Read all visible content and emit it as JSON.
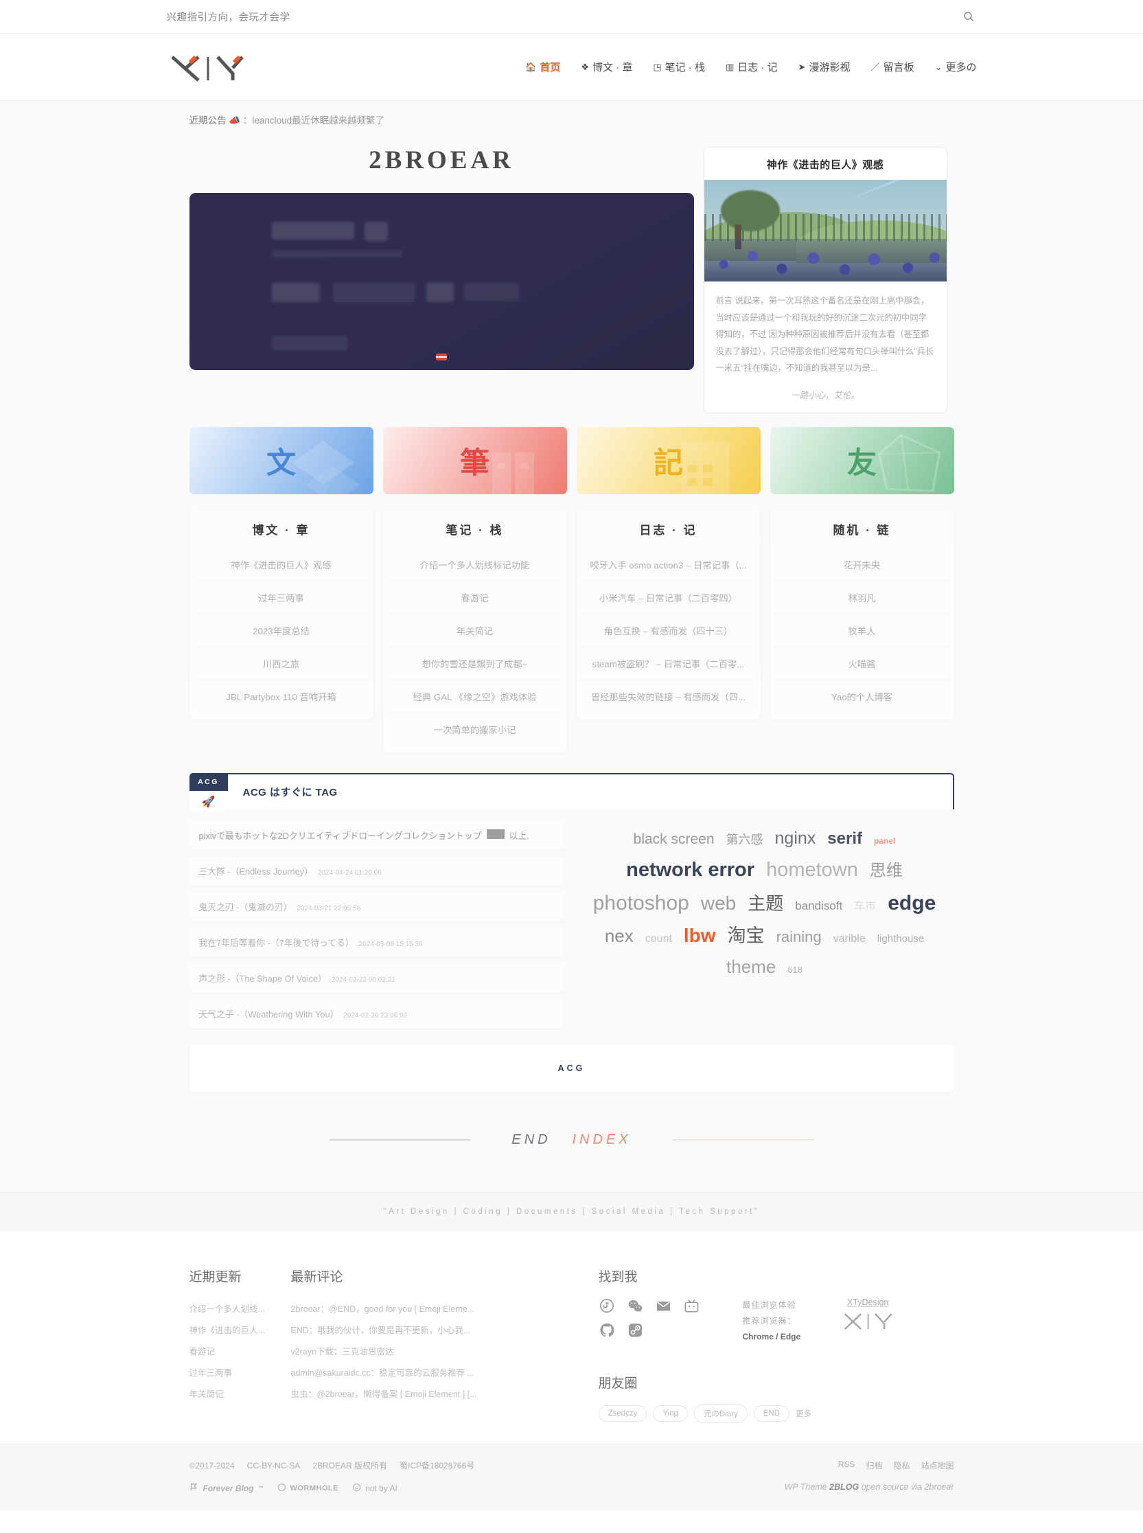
{
  "topbar": {
    "slogan": "兴趣指引方向，会玩才会学",
    "search_icon": "search-icon"
  },
  "header": {
    "logo_text": "XIY",
    "nav": [
      {
        "label": "首页",
        "icon": "home-icon",
        "active": true
      },
      {
        "label": "博文 · 章",
        "icon": "layers-icon",
        "active": false
      },
      {
        "label": "笔记 · 栈",
        "icon": "chart-icon",
        "active": false
      },
      {
        "label": "日志 · 记",
        "icon": "calendar-icon",
        "active": false
      },
      {
        "label": "漫游影视",
        "icon": "paper-plane-icon",
        "active": false
      },
      {
        "label": "留言板",
        "icon": "pen-icon",
        "active": false
      },
      {
        "label": "更多の",
        "icon": "chevron-down-icon",
        "active": false
      }
    ]
  },
  "notice": {
    "label": "近期公告",
    "icon": "megaphone-icon",
    "text": "：leancloud最近休眠越来越频繁了"
  },
  "hero": {
    "site_title": "2BROEAR"
  },
  "feature": {
    "title": "神作《进击的巨人》观感",
    "excerpt": "前言 说起来，第一次耳熟这个番名还是在刚上高中那会，当时应该是通过一个和我玩的好的沉迷二次元的初中同学得知的，不过 因为种种原因被推荐后并没有去看（甚至都没去了解过），只记得那会他们经常有句口头禅叫什么”兵长一米五“挂在嘴边，不知道的我甚至以为是...",
    "signature": "一路小心，艾伦。"
  },
  "categories": [
    {
      "glyph": "文",
      "color": "#4a86d8",
      "bg_from": "#eaf2fd",
      "bg_to": "#6ba3e6",
      "name": "category-card-wen"
    },
    {
      "glyph": "筆",
      "color": "#e04a44",
      "bg_from": "#fdecec",
      "bg_to": "#ef7b72",
      "name": "category-card-bi"
    },
    {
      "glyph": "記",
      "color": "#eab321",
      "bg_from": "#fdf7df",
      "bg_to": "#f6cf4e",
      "name": "category-card-ji"
    },
    {
      "glyph": "友",
      "color": "#4fa06b",
      "bg_from": "#eaf6ee",
      "bg_to": "#79c193",
      "name": "category-card-you"
    }
  ],
  "lists": [
    {
      "title": "博文 · 章",
      "items": [
        "神作《进击的巨人》观感",
        "过年三两事",
        "2023年度总结",
        "川西之旅",
        "JBL Partybox 110 音响开箱"
      ]
    },
    {
      "title": "笔记 · 栈",
      "items": [
        "介绍一个多人划线标记功能",
        "春游记",
        "年关简记",
        "想你的雪还是飘到了成都~",
        "经典 GAL 《缘之空》游戏体验",
        "一次简单的搬家小记"
      ]
    },
    {
      "title": "日志 · 记",
      "items": [
        "咬牙入手 osmo action3 – 日常记事（...",
        "小米汽车 – 日常记事（二百零四）",
        "角色互换 – 有感而发（四十三）",
        "steam被盗刷？ – 日常记事（二百零...",
        "曾经那些失效的链接 – 有感而发（四..."
      ]
    },
    {
      "title": "随机 · 链",
      "items": [
        "花开未央",
        "林羽凡",
        "牧羊人",
        "火喵酱",
        "Yao的个人博客"
      ]
    }
  ],
  "acg": {
    "tab_label": "ACG",
    "tab_icon": "rocket-icon",
    "bar_title": "ACG はすぐに TAG",
    "footer_label": "ACG",
    "anime": [
      {
        "title": "pixivで最もホットな2Dクリエイティブドローイングコレクショントップ",
        "redacted": true,
        "suffix": "以上.",
        "date": ""
      },
      {
        "title": "三大隊 -（Endless Journey）",
        "date": "2024-04-24 01:20:06"
      },
      {
        "title": "鬼灭之刃 -（鬼滅の刃）",
        "date": "2024-03-21 22:05:58"
      },
      {
        "title": "我在7年后等着你 -（7年後で待ってる）",
        "date": "2024-03-08 15:15:36"
      },
      {
        "title": "声之形 -（The Shape Of Voice）",
        "date": "2024-02-22 00:02:21"
      },
      {
        "title": "天气之子 -（Weathering With You）",
        "date": "2024-02-20 23:06:00"
      }
    ],
    "tags": [
      {
        "label": "black screen",
        "size": 21,
        "color": "#9a9a9a",
        "weight": 400
      },
      {
        "label": "第六感",
        "size": 18,
        "color": "#9f9f9f",
        "weight": 400
      },
      {
        "label": "nginx",
        "size": 25,
        "color": "#6d7480",
        "weight": 400
      },
      {
        "label": "serif",
        "size": 24,
        "color": "#4a5164",
        "weight": 700
      },
      {
        "label": "panel",
        "size": 12,
        "color": "#f19b8a",
        "weight": 700
      },
      {
        "label": "network error",
        "size": 29,
        "color": "#3c4558",
        "weight": 700
      },
      {
        "label": "hometown",
        "size": 29,
        "color": "#b3b3b3",
        "weight": 400
      },
      {
        "label": "思维",
        "size": 24,
        "color": "#9b9b9b",
        "weight": 400
      },
      {
        "label": "photoshop",
        "size": 30,
        "color": "#a0a0a0",
        "weight": 400
      },
      {
        "label": "web",
        "size": 28,
        "color": "#9d9d9d",
        "weight": 400
      },
      {
        "label": "主题",
        "size": 26,
        "color": "#5c5c5c",
        "weight": 400
      },
      {
        "label": "bandisoft",
        "size": 17,
        "color": "#909090",
        "weight": 400
      },
      {
        "label": "车市",
        "size": 16,
        "color": "#dcdcdc",
        "weight": 400
      },
      {
        "label": "edge",
        "size": 30,
        "color": "#3c4558",
        "weight": 700
      },
      {
        "label": "nex",
        "size": 26,
        "color": "#8d8d8d",
        "weight": 400
      },
      {
        "label": "count",
        "size": 16,
        "color": "#c2c2c2",
        "weight": 400
      },
      {
        "label": "lbw",
        "size": 28,
        "color": "#ef5b2b",
        "weight": 700
      },
      {
        "label": "淘宝",
        "size": 27,
        "color": "#606060",
        "weight": 400
      },
      {
        "label": "raining",
        "size": 22,
        "color": "#9e9e9e",
        "weight": 400
      },
      {
        "label": "varible",
        "size": 16,
        "color": "#b5b5b5",
        "weight": 400
      },
      {
        "label": "lighthouse",
        "size": 15,
        "color": "#b0b0b0",
        "weight": 400
      },
      {
        "label": "theme",
        "size": 26,
        "color": "#a5a5a5",
        "weight": 400
      },
      {
        "label": "618",
        "size": 13,
        "color": "#b5b5b5",
        "weight": 400
      }
    ]
  },
  "end_index": {
    "end": "END",
    "index": "INDEX"
  },
  "tagstrip": {
    "text": "\"Art Design | Coding | Documents | Social Media | Tech Support\""
  },
  "footer": {
    "recent": {
      "heading": "近期更新",
      "items": [
        "介绍一个多人划线...",
        "神作《进击的巨人...",
        "春游记",
        "过年三两事",
        "年关简记"
      ]
    },
    "comments": {
      "heading": "最新评论",
      "items": [
        "2broear：@END，good for you [ Emoji Eleme...",
        "END：哦我的伙计，你要是再不更新，小心我...",
        "v2rayn下载：三克油思密达",
        "admin@sakuraidc.cc：稳定可靠的云服务推荐 ...",
        "虫虫：@2broear，懒得备案 [ Emoji Element ] [..."
      ]
    },
    "find_me": {
      "heading": "找到我",
      "socials": [
        "netease-music-icon",
        "wechat-icon",
        "email-icon",
        "bilibili-icon",
        "github-icon",
        "steam-icon"
      ],
      "browser_line1": "最佳浏览体验",
      "browser_line2": "推荐浏览器：",
      "browser_line3": "Chrome / Edge",
      "xty_name": "XTyDesign",
      "xty_logo": "XIY"
    },
    "friends": {
      "heading": "朋友圈",
      "chips": [
        "Zsedczy",
        "Ying",
        "元のDiary",
        "END"
      ],
      "more": "更多"
    }
  },
  "bottom": {
    "copyright": "©2017-2024",
    "license": "CC-BY-NC-SA",
    "owner": "2BROEAR 版权所有",
    "icp": "蜀ICP备18028766号",
    "badges": [
      {
        "label": "Forever Blog",
        "sup": "™",
        "icon": "forever-blog-icon"
      },
      {
        "label": "WORMHOLE",
        "icon": "circle-icon"
      },
      {
        "label": "not by AI",
        "icon": "smile-icon"
      }
    ],
    "links": [
      "RSS",
      "归档",
      "隐私",
      "站点地图"
    ],
    "wp_prefix": "WP Theme ",
    "wp_name": "2BLOG",
    "wp_suffix": " open source via 2broear"
  }
}
